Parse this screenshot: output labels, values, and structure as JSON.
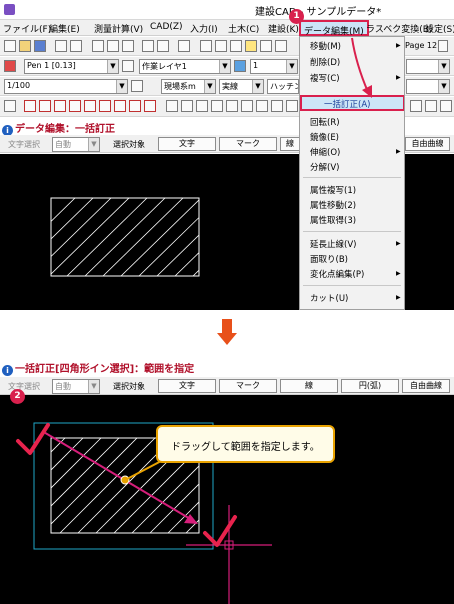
{
  "top": {
    "window_title": "建設CAD - サンプルデータ*",
    "menus": [
      "ファイル(F)",
      "編集(E)",
      "測量計算(V)",
      "CAD(Z)",
      "入力(I)",
      "土木(C)",
      "建設(K)",
      "データ編集(M)",
      "ラスベク変換(B)",
      "設定(S)"
    ],
    "pen_combo": "Pen 1 [0.13]",
    "layer_combo": "作業レイヤ1",
    "scale_combo": "1/100",
    "site_combo": "現場系m",
    "solid_combo": "実線",
    "hatch_combo": "ハッチング",
    "page_label": "Page  12",
    "linetype_combo": "1",
    "data_header": "データ編集：一括訂正",
    "option_label": "文字選択",
    "option_value": "自動",
    "target_label": "選択対象",
    "target_buttons": [
      "文字",
      "マーク",
      "線",
      "円(弧)",
      "自由曲線"
    ],
    "context_menu": [
      "移動(M)",
      "削除(D)",
      "複写(C)",
      "一括訂正(A)",
      "回転(R)",
      "鏡像(E)",
      "伸縮(O)",
      "分解(V)",
      "属性複写(1)",
      "属性移動(2)",
      "属性取得(3)",
      "延長止線(V)",
      "面取り(B)",
      "変化点編集(P)",
      "カット(U)"
    ],
    "step_badge": "1"
  },
  "bottom": {
    "data_header": "一括訂正[四角形イン選択]：範囲を指定",
    "option_label": "文字選択",
    "option_value": "自動",
    "target_label": "選択対象",
    "target_buttons": [
      "文字",
      "マーク",
      "線",
      "円(弧)",
      "自由曲線"
    ],
    "callout_text": "ドラッグして範囲を指定します。",
    "step_badge": "2"
  },
  "colors": {
    "accent": "#d9204d",
    "arrow": "#e8501a",
    "callout_border": "#e8a200",
    "selection_rect": "#1fa7c9",
    "drag_line": "#d61e7a",
    "check": "#e8234d"
  }
}
